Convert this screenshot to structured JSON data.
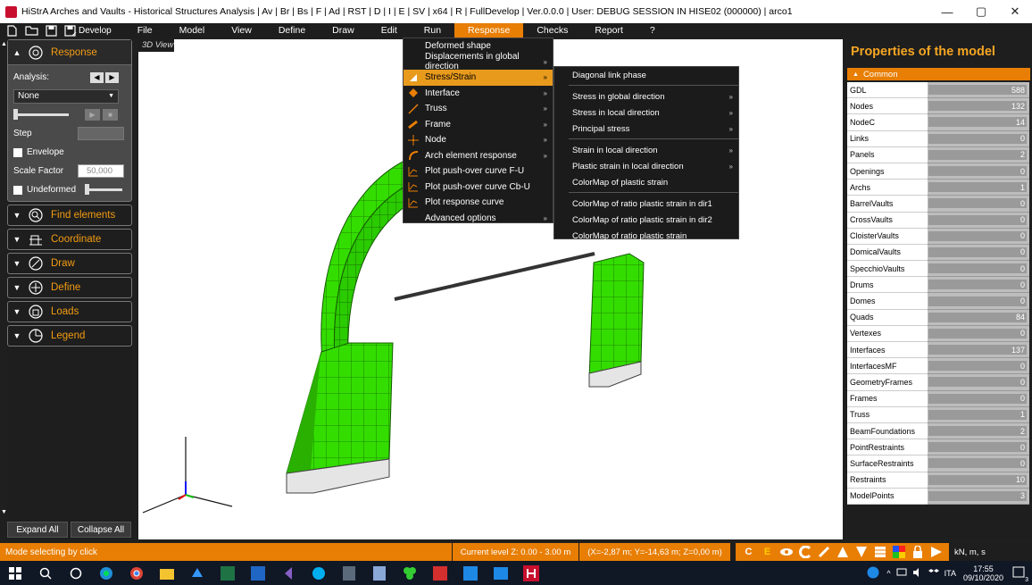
{
  "window": {
    "title": "HiStrA Arches and Vaults - Historical Structures Analysis | Av | Br | Bs | F | Ad | RST | D | I | E | SV | x64 | R | FullDevelop | Ver.0.0.0 | User: DEBUG SESSION IN HISE02 (000000) | arco1",
    "minimize": "—",
    "maximize": "▢",
    "close": "✕"
  },
  "menubar": {
    "develop": "Develop",
    "items": [
      "File",
      "Model",
      "View",
      "Define",
      "Draw",
      "Edit",
      "Run",
      "Response",
      "Checks",
      "Report",
      "?"
    ],
    "active": "Response"
  },
  "left_panel": {
    "response_header": "Response",
    "analysis_label": "Analysis:",
    "analysis_value": "None",
    "step_label": "Step",
    "envelope_label": "Envelope",
    "scale_factor_label": "Scale Factor",
    "scale_factor_value": "50,000",
    "undeformed_label": "Undeformed",
    "groups": [
      "Find elements",
      "Coordinate",
      "Draw",
      "Define",
      "Loads",
      "Legend"
    ],
    "expand_all": "Expand All",
    "collapse_all": "Collapse All"
  },
  "viewport": {
    "tab": "3D View"
  },
  "response_menu": {
    "items": [
      {
        "label": "Deformed shape",
        "arrow": ""
      },
      {
        "label": "Displacements in global direction",
        "arrow": "»"
      },
      {
        "label": "Stress/Strain",
        "arrow": "»"
      },
      {
        "label": "Interface",
        "arrow": "»"
      },
      {
        "label": "Truss",
        "arrow": "»"
      },
      {
        "label": "Frame",
        "arrow": "»"
      },
      {
        "label": "Node",
        "arrow": "»"
      },
      {
        "label": "Arch element response",
        "arrow": "»"
      },
      {
        "label": "Plot push-over curve F-U",
        "arrow": ""
      },
      {
        "label": "Plot push-over curve Cb-U",
        "arrow": ""
      },
      {
        "label": "Plot response curve",
        "arrow": ""
      },
      {
        "label": "Advanced options",
        "arrow": "»"
      }
    ],
    "highlighted": "Stress/Strain"
  },
  "stress_submenu": {
    "items": [
      {
        "label": "Diagonal link phase",
        "arrow": ""
      },
      {
        "label": "Stress in global direction",
        "arrow": "»"
      },
      {
        "label": "Stress in local direction",
        "arrow": "»"
      },
      {
        "label": "Principal stress",
        "arrow": "»"
      },
      {
        "label": "Strain in local direction",
        "arrow": "»"
      },
      {
        "label": "Plastic strain in local direction",
        "arrow": "»"
      },
      {
        "label": "ColorMap of plastic strain",
        "arrow": ""
      },
      {
        "label": "ColorMap of ratio plastic strain in dir1",
        "arrow": ""
      },
      {
        "label": "ColorMap of ratio plastic strain in dir2",
        "arrow": ""
      },
      {
        "label": "ColorMap of ratio plastic strain",
        "arrow": ""
      }
    ]
  },
  "properties": {
    "title": "Properties of the model",
    "section": "Common",
    "rows": [
      {
        "label": "GDL",
        "value": "588"
      },
      {
        "label": "Nodes",
        "value": "132"
      },
      {
        "label": "NodeC",
        "value": "14"
      },
      {
        "label": "Links",
        "value": "0"
      },
      {
        "label": "Panels",
        "value": "2"
      },
      {
        "label": "Openings",
        "value": "0"
      },
      {
        "label": "Archs",
        "value": "1"
      },
      {
        "label": "BarrelVaults",
        "value": "0"
      },
      {
        "label": "CrossVaults",
        "value": "0"
      },
      {
        "label": "CloisterVaults",
        "value": "0"
      },
      {
        "label": "DomicalVaults",
        "value": "0"
      },
      {
        "label": "SpecchioVaults",
        "value": "0"
      },
      {
        "label": "Drums",
        "value": "0"
      },
      {
        "label": "Domes",
        "value": "0"
      },
      {
        "label": "Quads",
        "value": "84"
      },
      {
        "label": "Vertexes",
        "value": "0"
      },
      {
        "label": "Interfaces",
        "value": "137"
      },
      {
        "label": "InterfacesMF",
        "value": "0"
      },
      {
        "label": "GeometryFrames",
        "value": "0"
      },
      {
        "label": "Frames",
        "value": "0"
      },
      {
        "label": "Truss",
        "value": "1"
      },
      {
        "label": "BeamFoundations",
        "value": "2"
      },
      {
        "label": "PointRestraints",
        "value": "0"
      },
      {
        "label": "SurfaceRestraints",
        "value": "0"
      },
      {
        "label": "Restraints",
        "value": "10"
      },
      {
        "label": "ModelPoints",
        "value": "3"
      }
    ]
  },
  "statusbar": {
    "mode": "Mode selecting by click",
    "level": "Current level Z: 0.00 - 3.00 m",
    "coords": "(X=-2,87 m; Y=-14,63 m; Z=0,00 m)",
    "tool_c": "C",
    "tool_e": "E",
    "units": "kN, m, s"
  },
  "taskbar": {
    "lang": "ITA",
    "time": "17:55",
    "date": "09/10/2020",
    "notif": "3"
  },
  "colors": {
    "accent": "#e87e04",
    "model_green": "#33dd00",
    "model_base": "#e5e5e5"
  }
}
